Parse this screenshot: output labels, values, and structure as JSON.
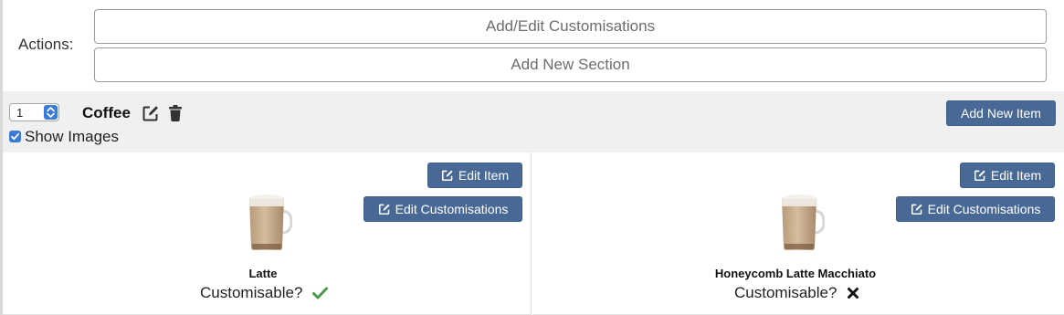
{
  "actions": {
    "label": "Actions:",
    "add_edit_customisations": "Add/Edit Customisations",
    "add_new_section": "Add New Section"
  },
  "section": {
    "order": "1",
    "name": "Coffee",
    "show_images_label": "Show Images",
    "show_images_checked": true,
    "add_new_item_label": "Add New Item"
  },
  "items": [
    {
      "name": "Latte",
      "customisable_label": "Customisable?",
      "customisable": true,
      "edit_item_label": "Edit Item",
      "edit_customisations_label": "Edit Customisations"
    },
    {
      "name": "Honeycomb Latte Macchiato",
      "customisable_label": "Customisable?",
      "customisable": false,
      "edit_item_label": "Edit Item",
      "edit_customisations_label": "Edit Customisations"
    }
  ],
  "colors": {
    "primary_button": "#486996",
    "section_background": "#f0f0f0",
    "check_green": "#4a9a4a",
    "cross_black": "#111111",
    "control_blue": "#3b7ad9"
  },
  "icons": {
    "edit": "edit-icon",
    "delete": "trash-icon",
    "customisable_yes": "check-icon",
    "customisable_no": "cross-icon"
  }
}
